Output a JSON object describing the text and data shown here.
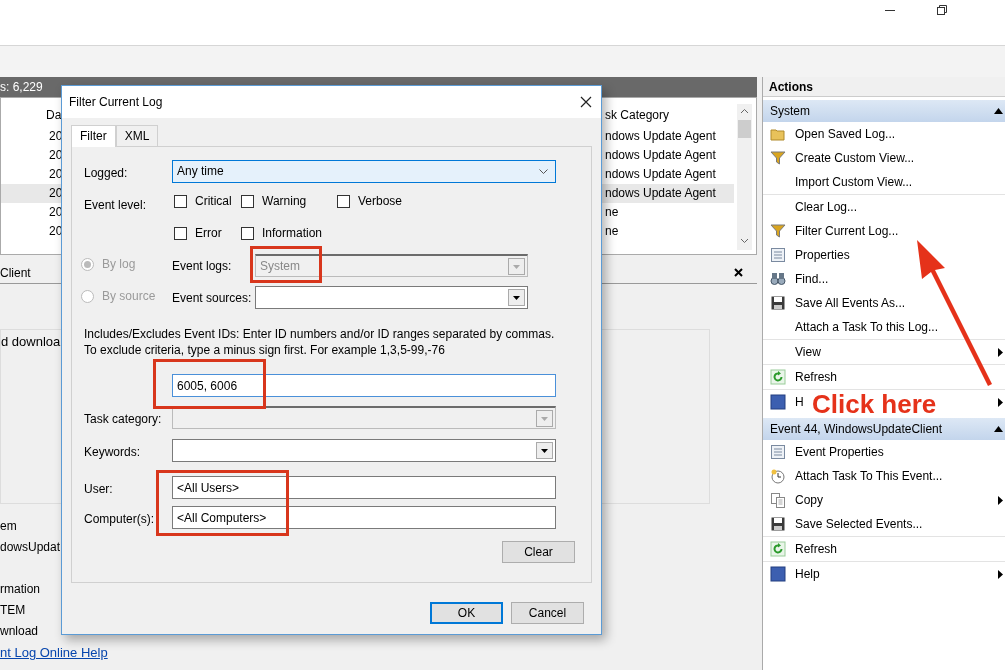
{
  "event_list": {
    "count": "s: 6,229",
    "columns": [
      "Da",
      "sk Category"
    ],
    "rows": [
      {
        "column_1": "20",
        "column_2": "ndows Update Agent",
        "selected": false
      },
      {
        "column_1": "20",
        "column_2": "ndows Update Agent",
        "selected": false
      },
      {
        "column_1": "20",
        "column_2": "ndows Update Agent",
        "selected": false
      },
      {
        "column_1": "20",
        "column_2": "ndows Update Agent",
        "selected": true
      },
      {
        "column_1": "20",
        "column_2": "ne",
        "selected": false
      },
      {
        "column_1": "20",
        "column_2": "ne",
        "selected": false
      }
    ]
  },
  "details": {
    "title": "Client",
    "description": "d downloa",
    "fields": [
      "em",
      "dowsUpdat",
      "rmation",
      "TEM",
      "wnload"
    ],
    "help_link": "nt Log Online Help"
  },
  "dialog": {
    "title": "Filter Current Log",
    "tabs": [
      {
        "label": "Filter",
        "selected": true
      },
      {
        "label": "XML",
        "selected": false
      }
    ],
    "logged": {
      "label": "Logged:",
      "value": "Any time"
    },
    "event_level": {
      "label": "Event level:",
      "options": [
        {
          "label": "Critical",
          "checked": false
        },
        {
          "label": "Warning",
          "checked": false
        },
        {
          "label": "Verbose",
          "checked": false
        },
        {
          "label": "Error",
          "checked": false
        },
        {
          "label": "Information",
          "checked": false
        }
      ]
    },
    "source_mode": [
      {
        "label": "By log",
        "selected": true,
        "disabled": true
      },
      {
        "label": "By source",
        "selected": false,
        "disabled": true
      }
    ],
    "event_logs": {
      "label": "Event logs:",
      "value": "System",
      "disabled": true
    },
    "event_sources": {
      "label": "Event sources:",
      "disabled": false
    },
    "ids_help": "Includes/Excludes Event IDs: Enter ID numbers and/or ID ranges separated by commas. To exclude criteria, type a minus sign first. For example 1,3,5-99,-76",
    "ids_value": "6005, 6006",
    "task_category": {
      "label": "Task category:",
      "disabled": true
    },
    "keywords": {
      "label": "Keywords:",
      "disabled": false
    },
    "user": {
      "label": "User:",
      "value": "<All Users>"
    },
    "computers": {
      "label": "Computer(s):",
      "value": "<All Computers>"
    },
    "clear_button": "Clear",
    "buttons": [
      {
        "label": "OK",
        "default": true
      },
      {
        "label": "Cancel",
        "default": false
      }
    ]
  },
  "actions": {
    "title": "Actions",
    "sections": [
      {
        "title": "System",
        "groups": [
          [
            {
              "label": "Open Saved Log...",
              "kind": "folder",
              "submenu": false
            },
            {
              "label": "Create Custom View...",
              "kind": "funnel",
              "submenu": false
            },
            {
              "label": "Import Custom View...",
              "kind": "none",
              "submenu": false
            }
          ],
          [
            {
              "label": "Clear Log...",
              "kind": "none",
              "submenu": false
            },
            {
              "label": "Filter Current Log...",
              "kind": "funnel",
              "submenu": false
            },
            {
              "label": "Properties",
              "kind": "sheet",
              "submenu": false
            },
            {
              "label": "Find...",
              "kind": "binoculars",
              "submenu": false
            },
            {
              "label": "Save All Events As...",
              "kind": "disk",
              "submenu": false
            },
            {
              "label": "Attach a Task To this Log...",
              "kind": "none",
              "submenu": false
            }
          ],
          [
            {
              "label": "View",
              "kind": "none",
              "submenu": true
            }
          ],
          [
            {
              "label": "Refresh",
              "kind": "refresh",
              "submenu": false
            }
          ],
          [
            {
              "label": "H",
              "kind": "help",
              "submenu": true
            }
          ]
        ]
      },
      {
        "title": "Event 44, WindowsUpdateClient",
        "groups": [
          [
            {
              "label": "Event Properties",
              "kind": "sheet",
              "submenu": false
            },
            {
              "label": "Attach Task To This Event...",
              "kind": "clock",
              "submenu": false
            },
            {
              "label": "Copy",
              "kind": "copy",
              "submenu": true
            },
            {
              "label": "Save Selected Events...",
              "kind": "disk",
              "submenu": false
            }
          ],
          [
            {
              "label": "Refresh",
              "kind": "refresh",
              "submenu": false
            }
          ],
          [
            {
              "label": "Help",
              "kind": "help",
              "submenu": true
            }
          ]
        ]
      }
    ]
  },
  "annotation": {
    "callout": "Click here"
  }
}
